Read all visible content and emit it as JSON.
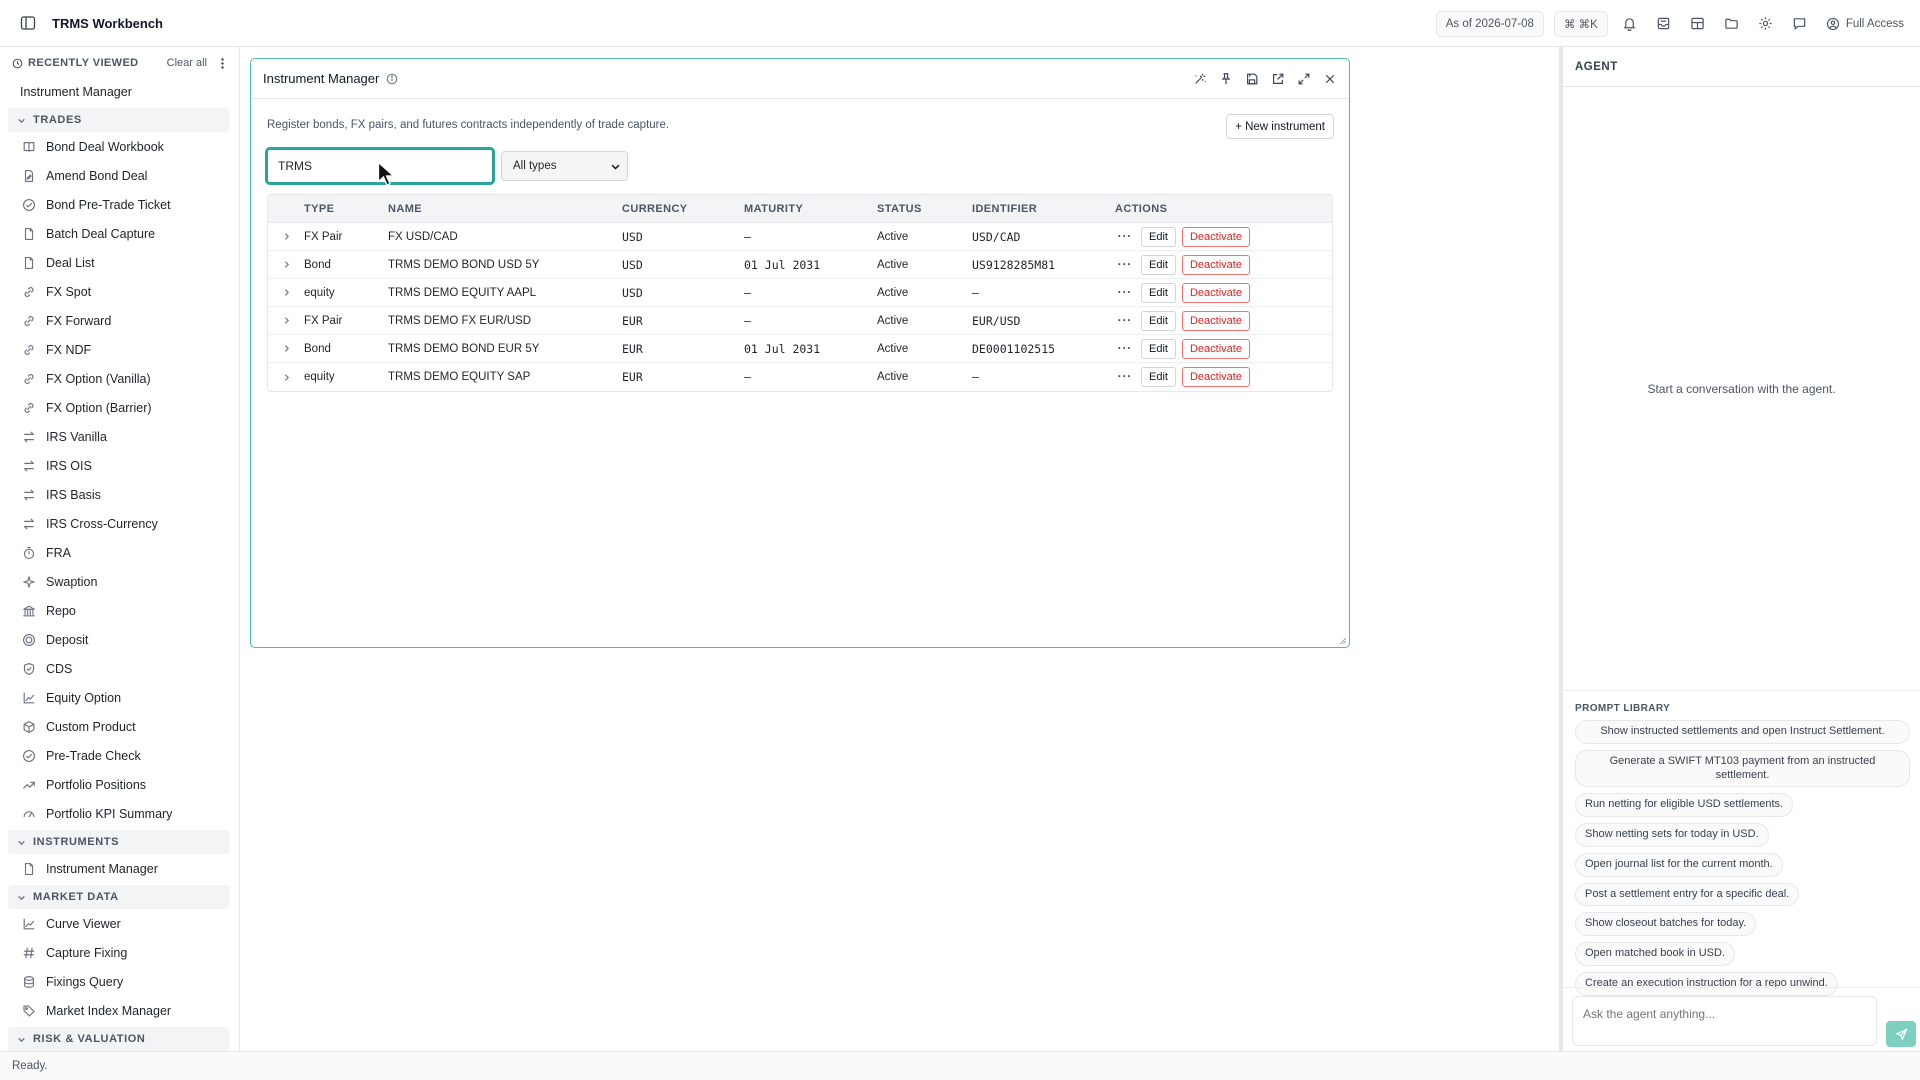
{
  "app": {
    "title": "TRMS Workbench"
  },
  "topbar": {
    "as_of": "As of 2026-07-08",
    "shortcut": "⌘ ⌘K",
    "access": "Full Access"
  },
  "sidebar": {
    "recent_label": "RECENTLY VIEWED",
    "clear_label": "Clear all",
    "recent_items": [
      "Instrument Manager"
    ],
    "sections": [
      {
        "label": "TRADES",
        "items": [
          {
            "label": "Bond Deal Workbook",
            "icon": "book-icon"
          },
          {
            "label": "Amend Bond Deal",
            "icon": "file-edit-icon"
          },
          {
            "label": "Bond Pre-Trade Ticket",
            "icon": "check-circle-icon"
          },
          {
            "label": "Batch Deal Capture",
            "icon": "file-icon"
          },
          {
            "label": "Deal List",
            "icon": "file-icon"
          },
          {
            "label": "FX Spot",
            "icon": "link-icon"
          },
          {
            "label": "FX Forward",
            "icon": "link-icon"
          },
          {
            "label": "FX NDF",
            "icon": "link-icon"
          },
          {
            "label": "FX Option (Vanilla)",
            "icon": "link-icon"
          },
          {
            "label": "FX Option (Barrier)",
            "icon": "link-icon"
          },
          {
            "label": "IRS Vanilla",
            "icon": "swap-icon"
          },
          {
            "label": "IRS OIS",
            "icon": "swap-icon"
          },
          {
            "label": "IRS Basis",
            "icon": "swap-icon"
          },
          {
            "label": "IRS Cross-Currency",
            "icon": "swap-icon"
          },
          {
            "label": "FRA",
            "icon": "timer-icon"
          },
          {
            "label": "Swaption",
            "icon": "sparkle-icon"
          },
          {
            "label": "Repo",
            "icon": "bank-icon"
          },
          {
            "label": "Deposit",
            "icon": "coin-icon"
          },
          {
            "label": "CDS",
            "icon": "shield-icon"
          },
          {
            "label": "Equity Option",
            "icon": "chart-icon"
          },
          {
            "label": "Custom Product",
            "icon": "box-icon"
          },
          {
            "label": "Pre-Trade Check",
            "icon": "check-circle-icon"
          },
          {
            "label": "Portfolio Positions",
            "icon": "trend-icon"
          },
          {
            "label": "Portfolio KPI Summary",
            "icon": "gauge-icon"
          }
        ]
      },
      {
        "label": "INSTRUMENTS",
        "items": [
          {
            "label": "Instrument Manager",
            "icon": "file-icon"
          }
        ]
      },
      {
        "label": "MARKET DATA",
        "items": [
          {
            "label": "Curve Viewer",
            "icon": "chart-icon"
          },
          {
            "label": "Capture Fixing",
            "icon": "hash-icon"
          },
          {
            "label": "Fixings Query",
            "icon": "database-icon"
          },
          {
            "label": "Market Index Manager",
            "icon": "tag-icon"
          }
        ]
      },
      {
        "label": "RISK & VALUATION",
        "items": []
      }
    ]
  },
  "panel": {
    "title": "Instrument Manager",
    "description": "Register bonds, FX pairs, and futures contracts independently of trade capture.",
    "new_button": "+ New instrument",
    "search_value": "TRMS",
    "type_filter": "All types",
    "columns": [
      "TYPE",
      "NAME",
      "CURRENCY",
      "MATURITY",
      "STATUS",
      "IDENTIFIER",
      "ACTIONS"
    ],
    "rows": [
      {
        "type": "FX Pair",
        "name": "FX USD/CAD",
        "currency": "USD",
        "maturity": "—",
        "status": "Active",
        "identifier": "USD/CAD"
      },
      {
        "type": "Bond",
        "name": "TRMS DEMO BOND USD 5Y",
        "currency": "USD",
        "maturity": "01 Jul 2031",
        "status": "Active",
        "identifier": "US9128285M81"
      },
      {
        "type": "equity",
        "name": "TRMS DEMO EQUITY AAPL",
        "currency": "USD",
        "maturity": "—",
        "status": "Active",
        "identifier": "—"
      },
      {
        "type": "FX Pair",
        "name": "TRMS DEMO FX EUR/USD",
        "currency": "EUR",
        "maturity": "—",
        "status": "Active",
        "identifier": "EUR/USD"
      },
      {
        "type": "Bond",
        "name": "TRMS DEMO BOND EUR 5Y",
        "currency": "EUR",
        "maturity": "01 Jul 2031",
        "status": "Active",
        "identifier": "DE0001102515"
      },
      {
        "type": "equity",
        "name": "TRMS DEMO EQUITY SAP",
        "currency": "EUR",
        "maturity": "—",
        "status": "Active",
        "identifier": "—"
      }
    ],
    "actions": {
      "more": "···",
      "edit": "Edit",
      "deactivate": "Deactivate"
    }
  },
  "agent": {
    "title": "AGENT",
    "empty_text": "Start a conversation with the agent.",
    "library_label": "PROMPT LIBRARY",
    "prompts": [
      "Show instructed settlements and open Instruct Settlement.",
      "Generate a SWIFT MT103 payment from an instructed settlement.",
      "Run netting for eligible USD settlements.",
      "Show netting sets for today in USD.",
      "Open journal list for the current month.",
      "Post a settlement entry for a specific deal.",
      "Show closeout batches for today.",
      "Open matched book in USD.",
      "Create an execution instruction for a repo unwind."
    ],
    "input_placeholder": "Ask the agent anything..."
  },
  "status": {
    "text": "Ready."
  },
  "colors": {
    "accent": "#2aa398",
    "danger": "#dc2626",
    "send": "#7dcfbf"
  }
}
